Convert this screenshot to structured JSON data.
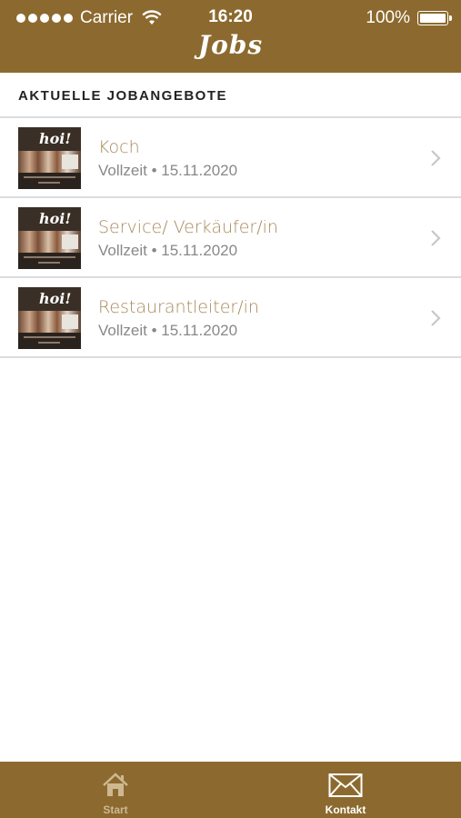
{
  "status_bar": {
    "carrier": "Carrier",
    "time": "16:20",
    "battery": "100%"
  },
  "nav": {
    "title": "Jobs"
  },
  "section": {
    "title": "AKTUELLE JOBANGEBOTE"
  },
  "thumbnail_logo": "hoi!",
  "jobs": [
    {
      "title": "Koch",
      "subtitle": "Vollzeit • 15.11.2020"
    },
    {
      "title": "Service/ Verkäufer/in",
      "subtitle": "Vollzeit • 15.11.2020"
    },
    {
      "title": "Restaurantleiter/in",
      "subtitle": "Vollzeit • 15.11.2020"
    }
  ],
  "tabbar": {
    "tabs": [
      {
        "label": "Start",
        "icon": "home-icon",
        "active": false
      },
      {
        "label": "Kontakt",
        "icon": "envelope-icon",
        "active": true
      }
    ]
  },
  "colors": {
    "brand": "#8c6a2f",
    "job_title": "#a88a5c",
    "subtitle": "#888888",
    "inactive_tab": "#cdb892"
  }
}
